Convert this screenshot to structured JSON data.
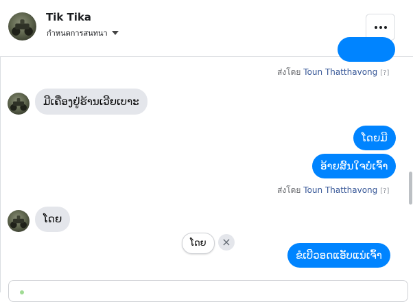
{
  "header": {
    "name": "Tik Tika",
    "subtitle": "กำหนดการสนทนา"
  },
  "sent_by": {
    "prefix": "ส่งโดย",
    "agent": "Toun Thatthavong",
    "help": "[?]"
  },
  "messages": {
    "in_1": "ມີເຄື່ອງຢູ່ຮ້ານເວີຍເບາະ",
    "out_1": "ໂດຍມີ",
    "out_2": "ອ້າຍສົນໃຈບໍ່ເຈົ້າ",
    "in_2": "ໂດຍ",
    "out_3": "ຂໍເບີວອດແອັບແນ່ເຈົ້າ"
  },
  "quick_reply": {
    "label": "ໂດຍ",
    "dismiss": "×"
  },
  "colors": {
    "outgoing_bubble": "#0084ff",
    "incoming_bubble": "#e4e6eb",
    "agent_link": "#385898"
  }
}
